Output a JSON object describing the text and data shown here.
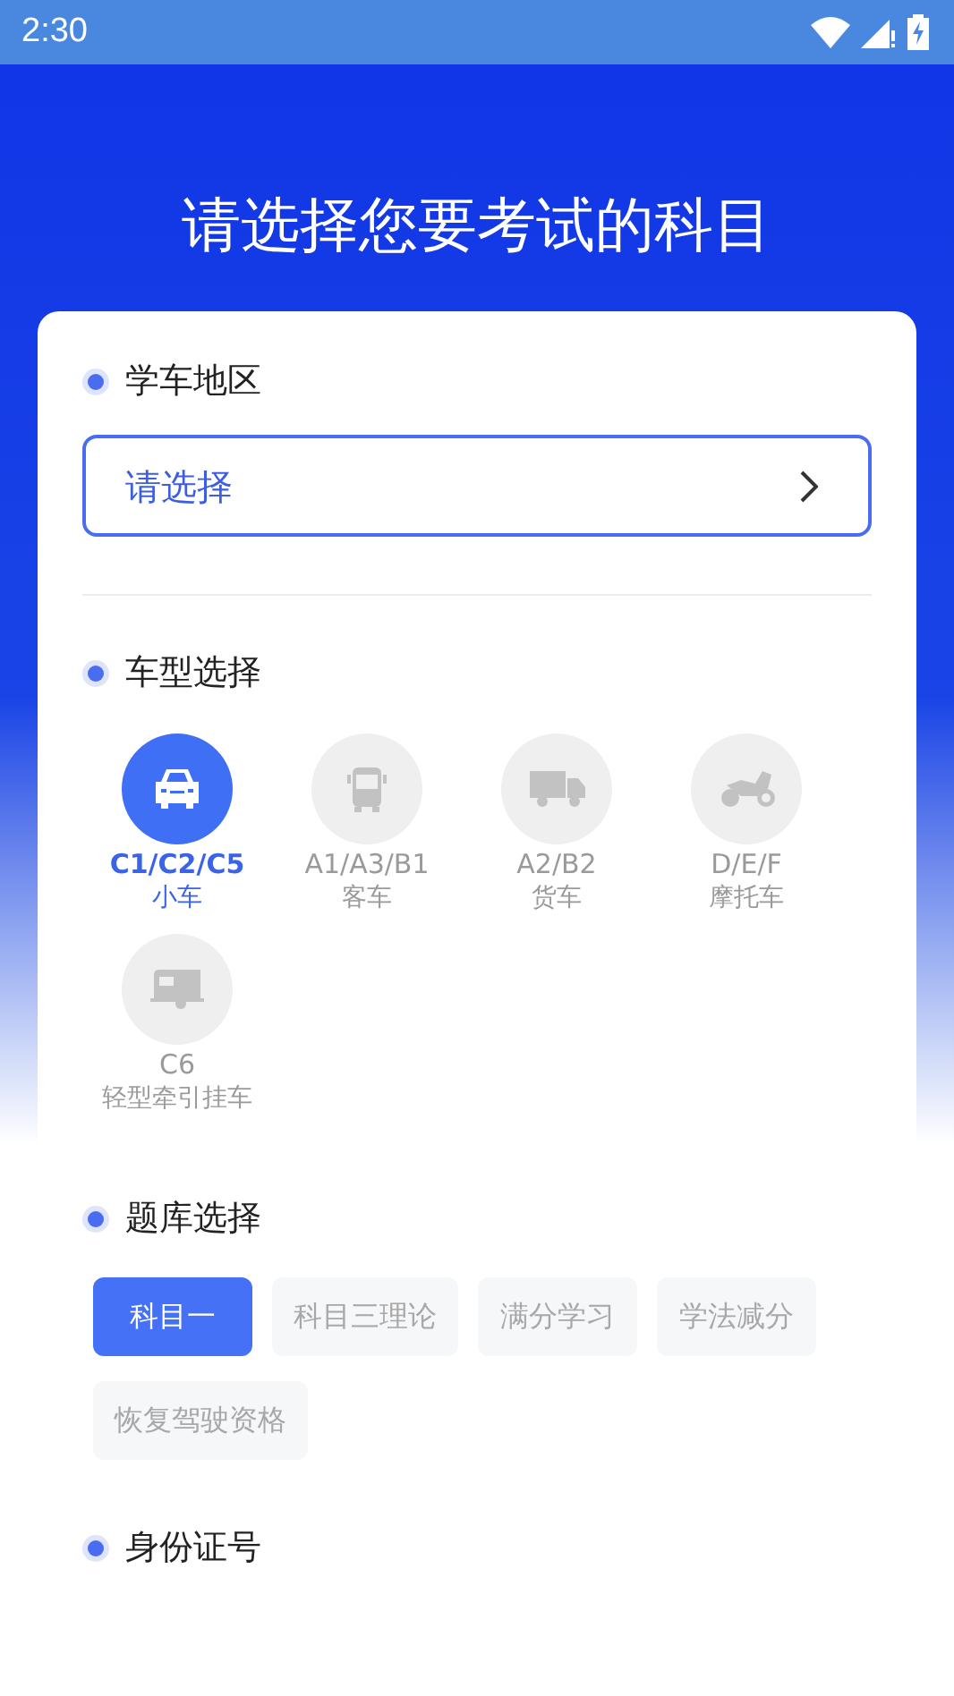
{
  "status_bar": {
    "time": "2:30"
  },
  "title": "请选择您要考试的科目",
  "sections": [
    {
      "kind": "select",
      "label": "学车地区",
      "placeholder": "请选择"
    },
    {
      "kind": "vehicles",
      "label": "车型选择",
      "items": [
        {
          "kind": "car",
          "code": "C1/C2/C5",
          "name": "小车",
          "selected": true
        },
        {
          "kind": "bus",
          "code": "A1/A3/B1",
          "name": "客车",
          "selected": false
        },
        {
          "kind": "truck",
          "code": "A2/B2",
          "name": "货车",
          "selected": false
        },
        {
          "kind": "motorcycle",
          "code": "D/E/F",
          "name": "摩托车",
          "selected": false
        },
        {
          "kind": "trailer",
          "code": "C6",
          "name": "轻型牵引挂车",
          "selected": false
        }
      ]
    },
    {
      "kind": "tags",
      "label": "题库选择",
      "items": [
        {
          "label": "科目一",
          "selected": true
        },
        {
          "label": "科目三理论",
          "selected": false
        },
        {
          "label": "满分学习",
          "selected": false
        },
        {
          "label": "学法减分",
          "selected": false
        },
        {
          "label": "恢复驾驶资格",
          "selected": false
        }
      ]
    },
    {
      "kind": "heading",
      "label": "身份证号"
    }
  ]
}
